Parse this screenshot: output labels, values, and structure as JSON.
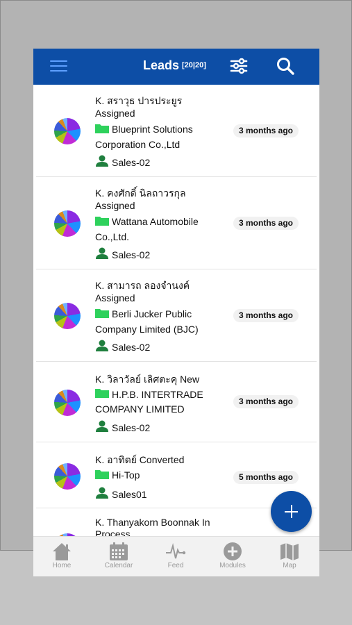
{
  "colors": {
    "header": "#0d4ea6",
    "accent_green": "#1f7f3e",
    "folder_green": "#2ed15c"
  },
  "header": {
    "title": "Leads",
    "count": "[20|20]"
  },
  "leads": [
    {
      "name": "K. สราวุธ ปารประยูร",
      "status": "Assigned",
      "company_line1": "Blueprint Solutions",
      "company_line2": "Corporation Co.,Ltd",
      "owner": "Sales-02",
      "time": "3 months ago"
    },
    {
      "name": "K. คงศักดิ์ นิลถาวรกุล",
      "status": "Assigned",
      "company_line1": "Wattana Automobile",
      "company_line2": "Co.,Ltd.",
      "owner": "Sales-02",
      "time": "3 months ago"
    },
    {
      "name": "K. สามารถ ลองจำนงค์",
      "status": "Assigned",
      "company_line1": "Berli Jucker Public",
      "company_line2": "Company Limited (BJC)",
      "owner": "Sales-02",
      "time": "3 months ago"
    },
    {
      "name": "K. วิลาวัลย์ เลิศตะคุ New",
      "status": "",
      "company_line1": "H.P.B. INTERTRADE",
      "company_line2": "COMPANY LIMITED",
      "owner": "Sales-02",
      "time": "3 months ago"
    },
    {
      "name": "K. อาทิตย์ Converted",
      "status": "",
      "company_line1": "Hi-Top",
      "company_line2": "",
      "owner": "Sales01",
      "time": "5 months ago"
    },
    {
      "name": "K. Thanyakorn Boonnak In",
      "status": "Process",
      "company_line1": "",
      "company_line2": "",
      "owner": "",
      "time": ""
    }
  ],
  "tabs": [
    {
      "label": "Home",
      "icon": "home-icon"
    },
    {
      "label": "Calendar",
      "icon": "calendar-icon"
    },
    {
      "label": "Feed",
      "icon": "pulse-icon"
    },
    {
      "label": "Modules",
      "icon": "plus-circle-icon"
    },
    {
      "label": "Map",
      "icon": "map-icon"
    }
  ]
}
